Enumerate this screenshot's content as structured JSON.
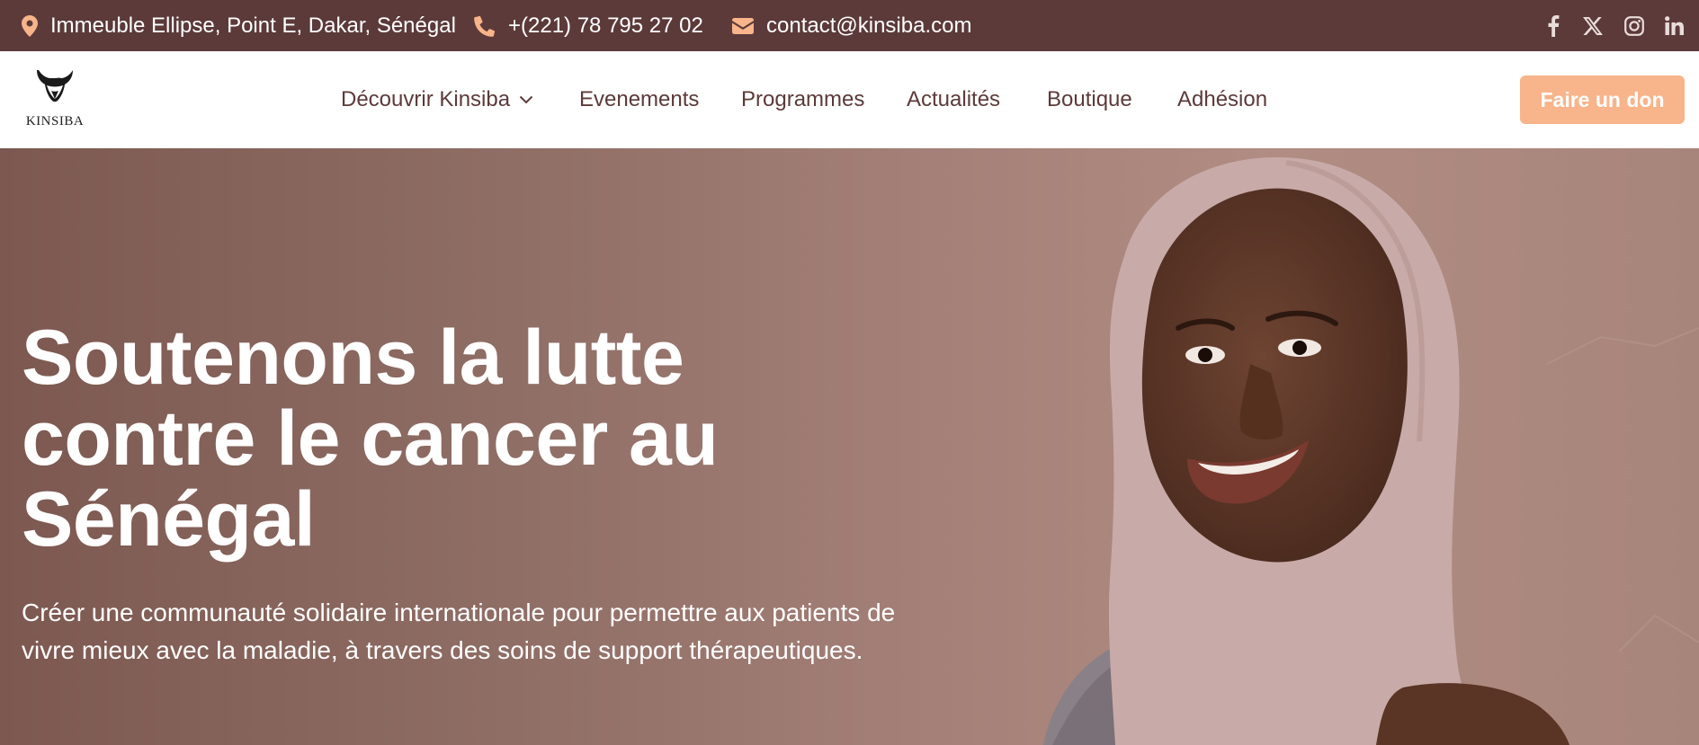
{
  "topbar": {
    "address": "Immeuble Ellipse, Point E, Dakar, Sénégal",
    "phone": "+(221) 78 795 27 02",
    "email": "contact@kinsiba.com",
    "socials": [
      "facebook-icon",
      "x-twitter-icon",
      "instagram-icon",
      "linkedin-icon"
    ],
    "icon_color": "#f8b48a",
    "bg_color": "#5c3a3a"
  },
  "header": {
    "logo_text": "KINSIBA",
    "nav": {
      "discover": "Découvrir Kinsiba",
      "events": "Evenements",
      "programs": "Programmes",
      "news": "Actualités",
      "shop": "Boutique",
      "membership": "Adhésion"
    },
    "donate_label": "Faire un don",
    "accent_color": "#f8b48a"
  },
  "hero": {
    "title": "Soutenons la lutte contre le cancer au Sénégal",
    "subtitle": "Créer une communauté solidaire internationale pour permettre aux patients de vivre mieux avec la maladie, à travers des soins de support thérapeutiques."
  }
}
